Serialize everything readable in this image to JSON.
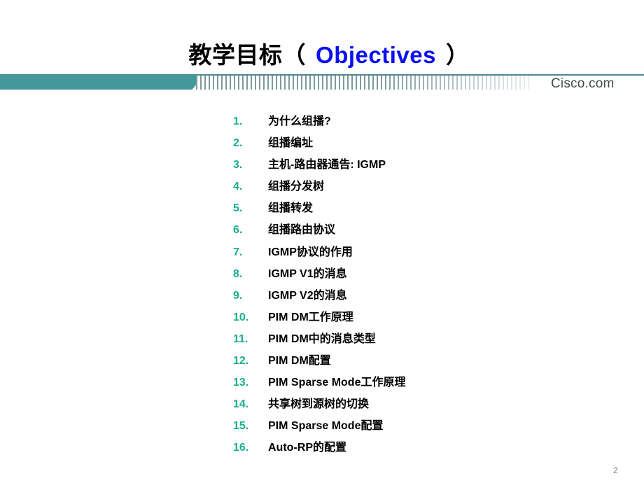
{
  "slide": {
    "title_cn": "教学目标（",
    "title_en": "Objectives",
    "title_close": "）",
    "brand": "Cisco.com",
    "page_number": "2",
    "colors": {
      "title_en": "#0a10f0",
      "number": "#1aae8c",
      "banner": "#44989c"
    }
  },
  "objectives": [
    {
      "num": "1.",
      "text": "为什么组播?"
    },
    {
      "num": "2.",
      "text": "组播编址"
    },
    {
      "num": "3.",
      "text": "主机-路由器通告: IGMP"
    },
    {
      "num": "4.",
      "text": "组播分发树"
    },
    {
      "num": "5.",
      "text": "组播转发"
    },
    {
      "num": "6.",
      "text": "组播路由协议"
    },
    {
      "num": "7.",
      "text": "IGMP协议的作用"
    },
    {
      "num": "8.",
      "text": "IGMP V1的消息"
    },
    {
      "num": "9.",
      "text": "IGMP V2的消息"
    },
    {
      "num": "10.",
      "text": "PIM DM工作原理"
    },
    {
      "num": "11.",
      "text": "PIM DM中的消息类型"
    },
    {
      "num": "12.",
      "text": "PIM DM配置"
    },
    {
      "num": "13.",
      "text": "PIM Sparse Mode工作原理"
    },
    {
      "num": "14.",
      "text": "共享树到源树的切换"
    },
    {
      "num": "15.",
      "text": "PIM Sparse Mode配置"
    },
    {
      "num": "16.",
      "text": "Auto-RP的配置"
    }
  ]
}
